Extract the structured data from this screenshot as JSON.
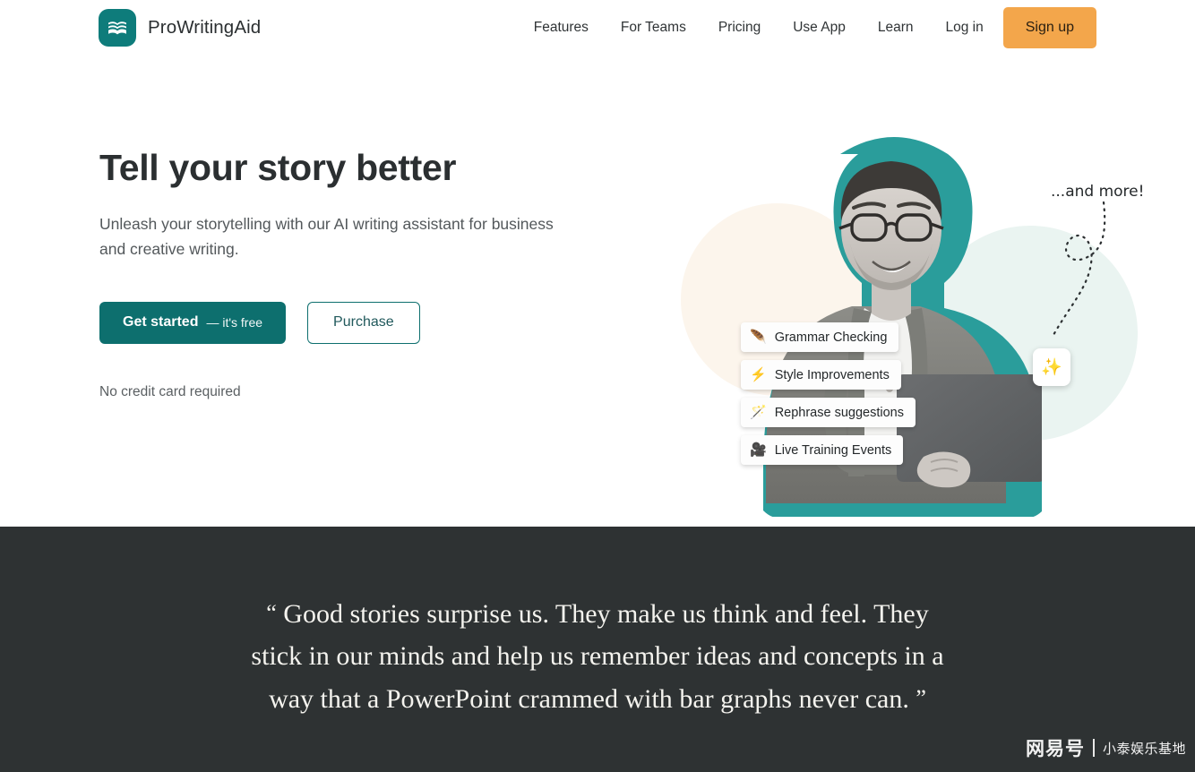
{
  "header": {
    "brand_name": "ProWritingAid",
    "logo_icon": "book-logo-icon",
    "nav_items": [
      {
        "label": "Features"
      },
      {
        "label": "For Teams"
      },
      {
        "label": "Pricing"
      },
      {
        "label": "Use App"
      },
      {
        "label": "Learn"
      }
    ],
    "login_label": "Log in",
    "signup_label": "Sign up",
    "signup_color": "#F3A64B"
  },
  "hero": {
    "title": "Tell your story better",
    "subtitle": "Unleash your storytelling with our AI writing assistant for business and creative writing.",
    "cta_primary_strong": "Get started",
    "cta_primary_thin": "— it's free",
    "cta_primary_color": "#0D6F6E",
    "cta_secondary": "Purchase",
    "note": "No credit card required",
    "art": {
      "more_label": "...and more!",
      "sparkle_emoji": "✨",
      "sticker_outline_color": "#2A9D9B",
      "blob_mint_color": "#EAF4F1",
      "blob_cream_color": "#FBF1E6",
      "chips": [
        {
          "emoji": "🪶",
          "label": "Grammar Checking"
        },
        {
          "emoji": "⚡",
          "label": "Style Improvements"
        },
        {
          "emoji": "🪄",
          "label": "Rephrase suggestions"
        },
        {
          "emoji": "🎥",
          "label": "Live Training Events"
        }
      ]
    }
  },
  "quote": {
    "open_mark": "“",
    "close_mark": "”",
    "line1": "Good stories surprise us. They make us think and feel.",
    "line2": "They stick in our minds and help us remember ideas",
    "line3": "and concepts in a way that a PowerPoint crammed with",
    "line4": "bar graphs never can.",
    "background_color": "#2E3233"
  },
  "watermark": {
    "main": "网易号",
    "sub": "小泰娱乐基地"
  }
}
